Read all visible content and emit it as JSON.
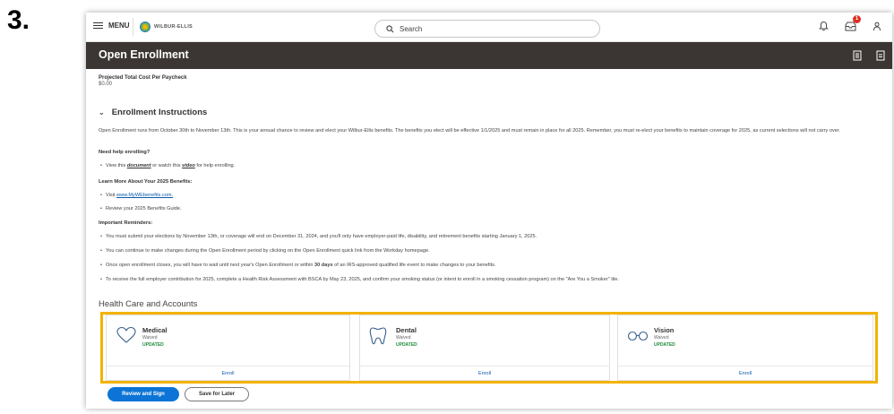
{
  "step_number": "3.",
  "topbar": {
    "menu_label": "MENU",
    "logo_text": "WILBUR-ELLIS",
    "search_placeholder": "Search",
    "notification_count": "1",
    "icons": [
      "bell-icon",
      "inbox-icon",
      "user-icon"
    ]
  },
  "page": {
    "title": "Open Enrollment",
    "title_icons": [
      "export-to-excel-icon",
      "pdf-icon"
    ]
  },
  "cost": {
    "label": "Projected Total Cost Per Paycheck",
    "value": "$0.00"
  },
  "instructions": {
    "heading": "Enrollment Instructions",
    "intro": "Open Enrollment runs from October 30th to November 13th. This is your annual chance to review and elect your Wilbur-Ellis benefits. The benefits you elect will be effective 1/1/2025 and must remain in place for all 2025. Remember, you must re-elect your benefits to maintain coverage for 2025, as current selections will not carry over.",
    "help_heading": "Need help enrolling?",
    "help_prefix": "View this",
    "help_doc_link": "document",
    "help_middle": "or watch this",
    "help_video_link": "video",
    "help_suffix": "for help enrolling.",
    "learn_heading": "Learn More About Your 2025 Benefits:",
    "learn_visit_prefix": "Visit",
    "learn_visit_link": "www.MyWEbenefits.com.",
    "learn_review": "Review your 2025 Benefits Guide.",
    "reminders_heading": "Important Reminders:",
    "reminder_1": "You must submit your elections by November 13th, or coverage will end on December 31, 2024, and you'll only have employer-paid life, disability, and retirement benefits starting January 1, 2025.",
    "reminder_2": "You can continue to make changes during the Open Enrollment period by clicking on the Open Enrollment quick link from the Workday homepage.",
    "reminder_3_prefix": "Once open enrollment closes, you will have to wait until next year's Open Enrollment or within",
    "reminder_3_bold": "30 days",
    "reminder_3_suffix": "of an IRS-approved qualified life event to make changes to your benefits.",
    "reminder_4": "To receive the full employer contribution for 2025, complete a Health Risk Assessment with BSCA by May 23, 2025, and confirm your smoking status (or intent to enroll in a smoking cessation program) on the \"Are You a Smoker\" tile."
  },
  "health_care": {
    "heading": "Health Care and Accounts",
    "cards": [
      {
        "name": "Medical",
        "status": "Waived",
        "badge": "UPDATED",
        "action": "Enroll",
        "icon": "heart-icon"
      },
      {
        "name": "Dental",
        "status": "Waived",
        "badge": "UPDATED",
        "action": "Enroll",
        "icon": "tooth-icon"
      },
      {
        "name": "Vision",
        "status": "Waived",
        "badge": "UPDATED",
        "action": "Enroll",
        "icon": "glasses-icon"
      }
    ]
  },
  "actions": {
    "review_sign": "Review and Sign",
    "save_later": "Save for Later"
  },
  "colors": {
    "highlight": "#f2b300",
    "primary": "#0b74d6",
    "title_bar": "#3b3633",
    "updated": "#1e8b3a"
  }
}
